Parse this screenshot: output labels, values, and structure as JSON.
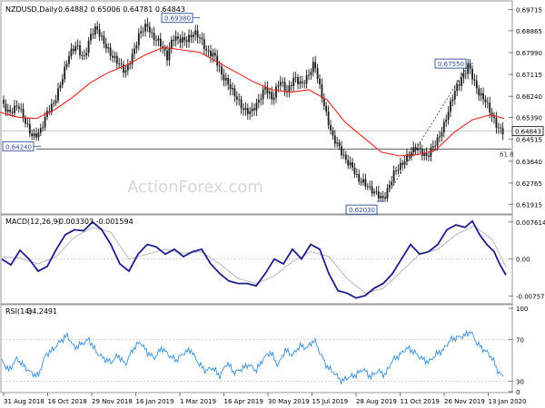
{
  "panels": {
    "price": {
      "title": "NZDUSD,Daily",
      "ohlc": "0.64882 0.65006 0.64781 0.64843"
    },
    "macd": {
      "title": "MACD(12,26,9)",
      "values": "-0.003303 -0.001594"
    },
    "rsi": {
      "title": "RSI(14)",
      "value": "34.2491"
    }
  },
  "watermark": "ActionForex.com",
  "colors": {
    "candle": "#1a1a1a",
    "ma": "#e8211b",
    "macd": "#1e1e8c",
    "macd_signal": "#b8b8b8",
    "rsi": "#3a8fd8",
    "grid": "#c8c8c8",
    "label_box": "#2a4a9a"
  },
  "chart_data": [
    {
      "type": "candlestick",
      "symbol": "NZDUSD",
      "timeframe": "Daily",
      "ylim": [
        0.616,
        0.6995
      ],
      "y_ticks": [
        "0.69715",
        "0.68865",
        "0.67990",
        "0.67115",
        "0.66240",
        "0.65390",
        "0.64515",
        "0.63640",
        "0.62765",
        "0.61915"
      ],
      "last_price": "0.64843",
      "annotations": [
        {
          "text": "0.69380",
          "value": 0.6938
        },
        {
          "text": "0.64240",
          "value": 0.6424
        },
        {
          "text": "0.67550",
          "value": 0.6755
        },
        {
          "text": "0.62030",
          "value": 0.6203
        }
      ],
      "fib_label": "61.8",
      "fib_level": 0.6413,
      "close_path": [
        [
          0,
          0.661
        ],
        [
          10,
          0.6555
        ],
        [
          20,
          0.659
        ],
        [
          28,
          0.652
        ],
        [
          36,
          0.646
        ],
        [
          44,
          0.648
        ],
        [
          52,
          0.656
        ],
        [
          60,
          0.66
        ],
        [
          68,
          0.669
        ],
        [
          76,
          0.679
        ],
        [
          84,
          0.683
        ],
        [
          92,
          0.677
        ],
        [
          100,
          0.687
        ],
        [
          106,
          0.69
        ],
        [
          114,
          0.684
        ],
        [
          122,
          0.679
        ],
        [
          130,
          0.676
        ],
        [
          138,
          0.672
        ],
        [
          146,
          0.679
        ],
        [
          154,
          0.688
        ],
        [
          162,
          0.691
        ],
        [
          168,
          0.686
        ],
        [
          176,
          0.684
        ],
        [
          184,
          0.678
        ],
        [
          190,
          0.686
        ],
        [
          198,
          0.685
        ],
        [
          206,
          0.685
        ],
        [
          214,
          0.688
        ],
        [
          220,
          0.686
        ],
        [
          228,
          0.68
        ],
        [
          236,
          0.679
        ],
        [
          244,
          0.671
        ],
        [
          252,
          0.667
        ],
        [
          260,
          0.662
        ],
        [
          268,
          0.657
        ],
        [
          276,
          0.656
        ],
        [
          284,
          0.66
        ],
        [
          292,
          0.666
        ],
        [
          300,
          0.661
        ],
        [
          308,
          0.669
        ],
        [
          316,
          0.664
        ],
        [
          324,
          0.67
        ],
        [
          332,
          0.667
        ],
        [
          340,
          0.671
        ],
        [
          346,
          0.676
        ],
        [
          352,
          0.666
        ],
        [
          360,
          0.654
        ],
        [
          366,
          0.646
        ],
        [
          372,
          0.643
        ],
        [
          380,
          0.637
        ],
        [
          388,
          0.634
        ],
        [
          394,
          0.629
        ],
        [
          400,
          0.628
        ],
        [
          408,
          0.625
        ],
        [
          416,
          0.623
        ],
        [
          422,
          0.621
        ],
        [
          428,
          0.626
        ],
        [
          434,
          0.632
        ],
        [
          442,
          0.635
        ],
        [
          450,
          0.639
        ],
        [
          458,
          0.642
        ],
        [
          464,
          0.64
        ],
        [
          470,
          0.638
        ],
        [
          476,
          0.642
        ],
        [
          482,
          0.645
        ],
        [
          488,
          0.65
        ],
        [
          494,
          0.657
        ],
        [
          500,
          0.664
        ],
        [
          506,
          0.668
        ],
        [
          512,
          0.672
        ],
        [
          516,
          0.675
        ],
        [
          522,
          0.668
        ],
        [
          528,
          0.663
        ],
        [
          534,
          0.661
        ],
        [
          540,
          0.656
        ],
        [
          546,
          0.651
        ],
        [
          552,
          0.6484
        ]
      ],
      "ma_path": [
        [
          0,
          0.656
        ],
        [
          20,
          0.654
        ],
        [
          40,
          0.6535
        ],
        [
          60,
          0.657
        ],
        [
          80,
          0.662
        ],
        [
          100,
          0.668
        ],
        [
          120,
          0.672
        ],
        [
          140,
          0.675
        ],
        [
          160,
          0.679
        ],
        [
          180,
          0.682
        ],
        [
          200,
          0.681
        ],
        [
          220,
          0.68
        ],
        [
          240,
          0.676
        ],
        [
          260,
          0.672
        ],
        [
          280,
          0.668
        ],
        [
          300,
          0.665
        ],
        [
          320,
          0.664
        ],
        [
          340,
          0.665
        ],
        [
          360,
          0.661
        ],
        [
          380,
          0.652
        ],
        [
          400,
          0.646
        ],
        [
          420,
          0.64
        ],
        [
          440,
          0.6385
        ],
        [
          460,
          0.639
        ],
        [
          480,
          0.641
        ],
        [
          500,
          0.648
        ],
        [
          520,
          0.653
        ],
        [
          540,
          0.655
        ],
        [
          555,
          0.6535
        ]
      ]
    },
    {
      "type": "line",
      "name": "MACD(12,26,9)",
      "ylim": [
        -0.0088,
        0.0085
      ],
      "y_ticks": [
        "0.007614",
        "0.00",
        "-0.007573"
      ],
      "series": [
        {
          "values": [
            [
              0,
              0.0
            ],
            [
              10,
              -0.0012
            ],
            [
              20,
              0.0018
            ],
            [
              30,
              0.0
            ],
            [
              40,
              -0.0025
            ],
            [
              50,
              -0.0015
            ],
            [
              60,
              0.002
            ],
            [
              70,
              0.005
            ],
            [
              80,
              0.006
            ],
            [
              90,
              0.0058
            ],
            [
              100,
              0.0076
            ],
            [
              110,
              0.006
            ],
            [
              120,
              0.003
            ],
            [
              130,
              -0.001
            ],
            [
              140,
              -0.0025
            ],
            [
              150,
              0.001
            ],
            [
              160,
              0.003
            ],
            [
              170,
              0.0025
            ],
            [
              180,
              0.001
            ],
            [
              190,
              0.002
            ],
            [
              200,
              0.0005
            ],
            [
              210,
              0.0015
            ],
            [
              220,
              0.002
            ],
            [
              230,
              -0.001
            ],
            [
              240,
              -0.003
            ],
            [
              250,
              -0.0045
            ],
            [
              260,
              -0.005
            ],
            [
              270,
              -0.005
            ],
            [
              280,
              -0.0055
            ],
            [
              290,
              -0.003
            ],
            [
              300,
              0.0
            ],
            [
              310,
              -0.001
            ],
            [
              320,
              0.002
            ],
            [
              330,
              0.0
            ],
            [
              340,
              0.003
            ],
            [
              350,
              0.002
            ],
            [
              360,
              -0.003
            ],
            [
              370,
              -0.0065
            ],
            [
              380,
              -0.007
            ],
            [
              390,
              -0.008
            ],
            [
              400,
              -0.0075
            ],
            [
              410,
              -0.006
            ],
            [
              420,
              -0.005
            ],
            [
              430,
              -0.003
            ],
            [
              440,
              0.0
            ],
            [
              450,
              0.003
            ],
            [
              460,
              0.001
            ],
            [
              470,
              0.0015
            ],
            [
              480,
              0.003
            ],
            [
              490,
              0.006
            ],
            [
              500,
              0.007
            ],
            [
              510,
              0.0065
            ],
            [
              518,
              0.0078
            ],
            [
              526,
              0.005
            ],
            [
              534,
              0.003
            ],
            [
              542,
              0.0015
            ],
            [
              548,
              -0.001
            ],
            [
              555,
              -0.0033
            ]
          ]
        },
        {
          "values": [
            [
              0,
              0.0005
            ],
            [
              20,
              0.0002
            ],
            [
              40,
              -0.001
            ],
            [
              60,
              0.0005
            ],
            [
              80,
              0.0045
            ],
            [
              100,
              0.0065
            ],
            [
              120,
              0.0055
            ],
            [
              140,
              0.0
            ],
            [
              160,
              0.001
            ],
            [
              180,
              0.002
            ],
            [
              200,
              0.0012
            ],
            [
              220,
              0.0015
            ],
            [
              240,
              -0.001
            ],
            [
              260,
              -0.004
            ],
            [
              280,
              -0.005
            ],
            [
              300,
              -0.0035
            ],
            [
              320,
              -0.0005
            ],
            [
              340,
              0.0015
            ],
            [
              360,
              0.0005
            ],
            [
              380,
              -0.004
            ],
            [
              400,
              -0.007
            ],
            [
              420,
              -0.006
            ],
            [
              440,
              -0.0025
            ],
            [
              460,
              0.001
            ],
            [
              480,
              0.002
            ],
            [
              500,
              0.005
            ],
            [
              520,
              0.0068
            ],
            [
              540,
              0.004
            ],
            [
              555,
              -0.0016
            ]
          ]
        }
      ]
    },
    {
      "type": "line",
      "name": "RSI(14)",
      "ylim": [
        20,
        100
      ],
      "y_ticks": [
        "100",
        "70",
        "30",
        "0"
      ],
      "series": [
        {
          "values": [
            [
              0,
              50
            ],
            [
              8,
              40
            ],
            [
              16,
              52
            ],
            [
              24,
              45
            ],
            [
              32,
              38
            ],
            [
              40,
              35
            ],
            [
              48,
              55
            ],
            [
              56,
              60
            ],
            [
              64,
              68
            ],
            [
              72,
              74
            ],
            [
              80,
              62
            ],
            [
              88,
              66
            ],
            [
              96,
              70
            ],
            [
              104,
              58
            ],
            [
              112,
              52
            ],
            [
              120,
              48
            ],
            [
              128,
              55
            ],
            [
              136,
              46
            ],
            [
              144,
              60
            ],
            [
              152,
              68
            ],
            [
              160,
              58
            ],
            [
              168,
              52
            ],
            [
              176,
              62
            ],
            [
              184,
              55
            ],
            [
              192,
              50
            ],
            [
              200,
              57
            ],
            [
              208,
              60
            ],
            [
              216,
              48
            ],
            [
              224,
              40
            ],
            [
              232,
              43
            ],
            [
              240,
              35
            ],
            [
              248,
              48
            ],
            [
              256,
              38
            ],
            [
              264,
              42
            ],
            [
              272,
              46
            ],
            [
              280,
              40
            ],
            [
              288,
              52
            ],
            [
              296,
              58
            ],
            [
              304,
              45
            ],
            [
              312,
              60
            ],
            [
              320,
              55
            ],
            [
              328,
              64
            ],
            [
              336,
              62
            ],
            [
              344,
              70
            ],
            [
              350,
              58
            ],
            [
              358,
              44
            ],
            [
              366,
              38
            ],
            [
              374,
              30
            ],
            [
              382,
              34
            ],
            [
              390,
              36
            ],
            [
              398,
              42
            ],
            [
              406,
              34
            ],
            [
              414,
              40
            ],
            [
              422,
              36
            ],
            [
              430,
              50
            ],
            [
              438,
              55
            ],
            [
              446,
              62
            ],
            [
              454,
              58
            ],
            [
              462,
              52
            ],
            [
              470,
              48
            ],
            [
              478,
              56
            ],
            [
              486,
              60
            ],
            [
              494,
              70
            ],
            [
              502,
              72
            ],
            [
              510,
              74
            ],
            [
              516,
              78
            ],
            [
              522,
              68
            ],
            [
              528,
              62
            ],
            [
              534,
              58
            ],
            [
              540,
              52
            ],
            [
              546,
              40
            ],
            [
              552,
              34
            ]
          ]
        }
      ]
    }
  ],
  "x_axis": {
    "labels": [
      "31 Aug 2018",
      "16 Oct 2018",
      "29 Nov 2018",
      "16 Jan 2019",
      "1 Mar 2019",
      "16 Apr 2019",
      "30 May 2019",
      "15 Jul 2019",
      "28 Aug 2019",
      "11 Oct 2019",
      "26 Nov 2019",
      "13 Jan 2020"
    ]
  }
}
